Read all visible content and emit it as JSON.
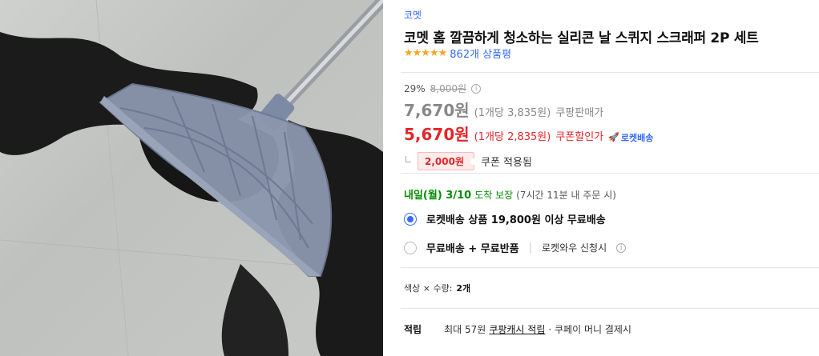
{
  "image": {
    "alt_icon": "product-photo"
  },
  "product": {
    "brand": "코멧",
    "title": "코멧 홈 깔끔하게 청소하는 실리콘 날 스퀴지 스크래퍼 2P 세트",
    "stars": "★★★★★",
    "review_count": "862개 상품평"
  },
  "price": {
    "discount_rate": "29%",
    "original": "8,000원",
    "sale": "7,670원",
    "sale_unit": "(1개당 3,835원)",
    "sale_label": "쿠팡판매가",
    "coupon": "5,670원",
    "coupon_unit": "(1개당 2,835원)",
    "coupon_label": "쿠폰할인가",
    "rocket_label": "로켓배송",
    "coupon_amount": "2,000원",
    "coupon_applied": "쿠폰 적용됨"
  },
  "delivery": {
    "date": "내일(월) 3/10",
    "guarantee": "도착 보장",
    "note": "(7시간 11분 내 주문 시)"
  },
  "options": [
    {
      "label": "로켓배송 상품 19,800원 이상 무료배송",
      "selected": true
    },
    {
      "label": "무료배송 + 무료반품",
      "extra": "로켓와우 신청시",
      "selected": false
    }
  ],
  "variant": {
    "label": "색상 × 수량:",
    "value": "2개"
  },
  "reward": {
    "label": "적립",
    "prefix": "최대 57원",
    "link": "쿠팡캐시 적립",
    "suffix": "· 쿠페이 머니 결제시"
  }
}
